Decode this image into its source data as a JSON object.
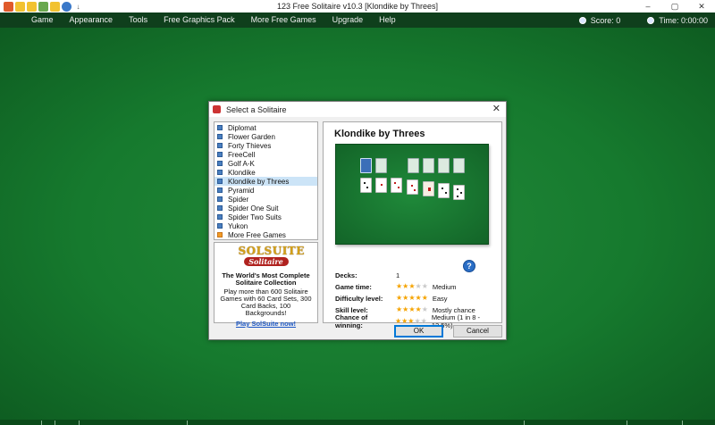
{
  "window": {
    "title": "123 Free Solitaire v10.3  [Klondike by Threes]",
    "controls": [
      "–",
      "▢",
      "✕"
    ]
  },
  "toolbar_icons": [
    "new-game-icon",
    "undo-icon",
    "hint-icon",
    "stats-icon",
    "select-game-icon",
    "help-icon",
    "pin-icon"
  ],
  "menu": [
    "Game",
    "Appearance",
    "Tools",
    "Free Graphics Pack",
    "More Free Games",
    "Upgrade",
    "Help"
  ],
  "status": {
    "score_label": "Score: 0",
    "time_label": "Time: 0:00:00"
  },
  "dialog": {
    "title": "Select a Solitaire",
    "close": "✕",
    "games": [
      {
        "label": "Diplomat"
      },
      {
        "label": "Flower Garden"
      },
      {
        "label": "Forty Thieves"
      },
      {
        "label": "FreeCell"
      },
      {
        "label": "Golf A-K"
      },
      {
        "label": "Klondike"
      },
      {
        "label": "Klondike by Threes"
      },
      {
        "label": "Pyramid"
      },
      {
        "label": "Spider"
      },
      {
        "label": "Spider One Suit"
      },
      {
        "label": "Spider Two Suits"
      },
      {
        "label": "Yukon"
      },
      {
        "label": "More Free Games"
      }
    ],
    "selected_game": "Klondike by Threes",
    "ad": {
      "logo_top": "SOLSUITE",
      "logo_bottom": "Solitaire",
      "heading": "The World's Most Complete Solitaire Collection",
      "body": "Play more than 600 Solitaire Games with 60 Card Sets, 300 Card Backs, 100 Backgrounds!",
      "link": "Play SolSuite now!"
    },
    "details": {
      "game_title": "Klondike by Threes",
      "stats": [
        {
          "label": "Decks:",
          "value": "1",
          "stars": null
        },
        {
          "label": "Game time:",
          "value": "Medium",
          "stars": 3
        },
        {
          "label": "Difficulty level:",
          "value": "Easy",
          "stars": 5
        },
        {
          "label": "Skill level:",
          "value": "Mostly chance",
          "stars": 4
        },
        {
          "label": "Chance of winning:",
          "value": "Medium (1 in 8  -  12.5%)",
          "stars": 3
        }
      ],
      "max_stars": 5
    },
    "ok_label": "OK",
    "cancel_label": "Cancel"
  },
  "colors": {
    "felt": "#15702c",
    "menubar": "#0f3f1c",
    "star_on": "#f5a300",
    "star_off": "#c9c9c9",
    "selection": "#cce4f7"
  }
}
